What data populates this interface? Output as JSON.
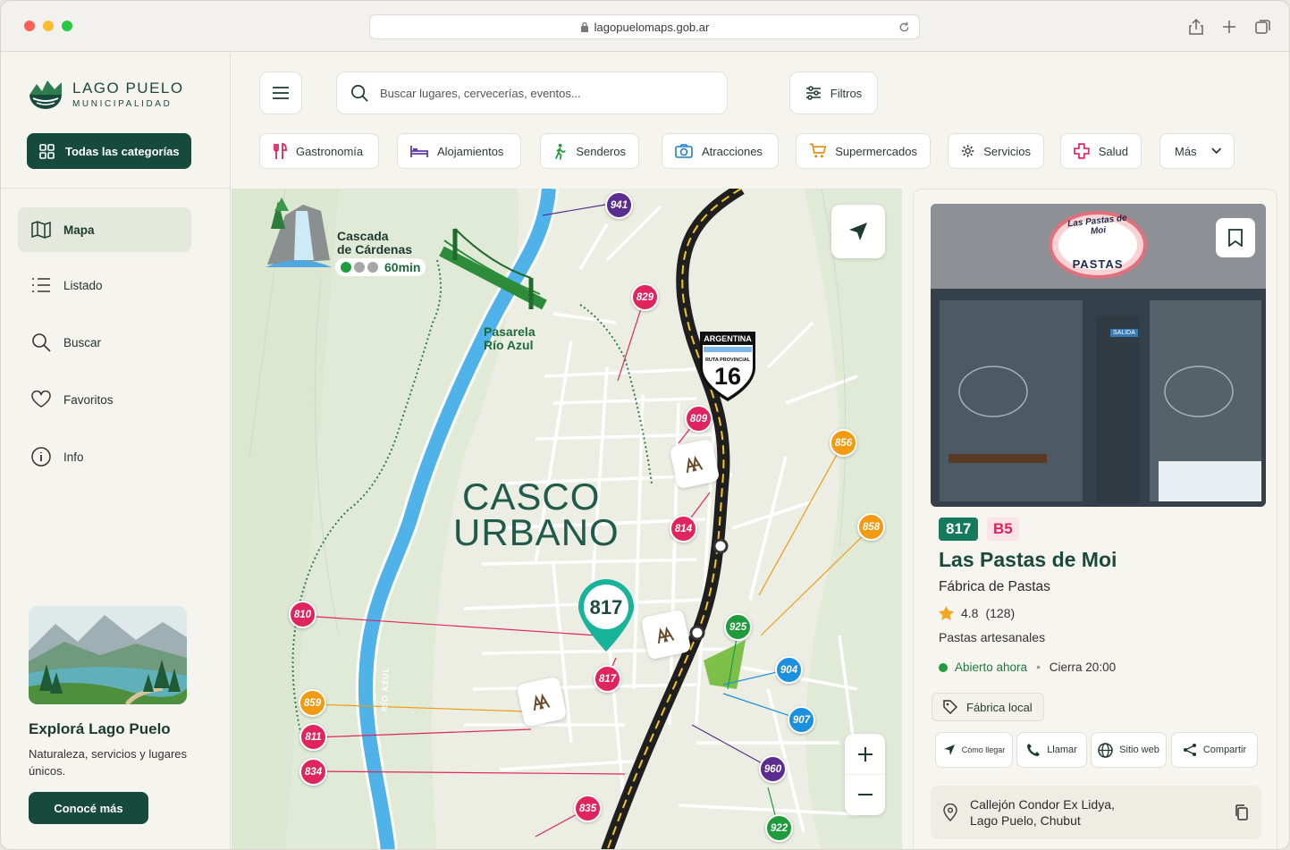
{
  "browser": {
    "url": "lagopuelomaps.gob.ar"
  },
  "brand": {
    "name": "LAGO PUELO",
    "subtitle": "MUNICIPALIDAD"
  },
  "sidebar": {
    "all_categories": "Todas las categorías",
    "items": [
      {
        "label": "Mapa",
        "icon": "map-icon",
        "active": true
      },
      {
        "label": "Listado",
        "icon": "list-icon"
      },
      {
        "label": "Buscar",
        "icon": "search-icon"
      },
      {
        "label": "Favoritos",
        "icon": "heart-icon"
      },
      {
        "label": "Info",
        "icon": "info-icon"
      }
    ],
    "promo": {
      "title": "Explorá Lago Puelo",
      "text": "Naturaleza, servicios y lugares únicos.",
      "button": "Conocé más"
    }
  },
  "search": {
    "placeholder": "Buscar lugares, cervecerías, eventos..."
  },
  "filters_label": "Filtros",
  "categories": [
    {
      "label": "Gastronomía",
      "icon": "fork-knife-icon",
      "color": "#e0245e"
    },
    {
      "label": "Alojamientos",
      "icon": "bed-icon",
      "color": "#5b3ea8"
    },
    {
      "label": "Senderos",
      "icon": "hiker-icon",
      "color": "#1f9a3c"
    },
    {
      "label": "Atracciones",
      "icon": "camera-icon",
      "color": "#1b7fd0"
    },
    {
      "label": "Supermercados",
      "icon": "cart-icon",
      "color": "#e38a0c"
    },
    {
      "label": "Servicios",
      "icon": "gear-icon",
      "color": "#333333"
    },
    {
      "label": "Salud",
      "icon": "cross-icon",
      "color": "#e0245e"
    },
    {
      "label": "Más",
      "icon": "chevron-down-icon",
      "color": "#333333"
    }
  ],
  "map": {
    "area_label_1": "CASCO",
    "area_label_2": "URBANO",
    "waterfall_label_1": "Cascada",
    "waterfall_label_2": "de Cárdenas",
    "waterfall_time": "60min",
    "bridge_label_1": "Pasarela",
    "bridge_label_2": "Río Azul",
    "river_label": "RÍO AZUL",
    "route_sign_top": "ARGENTINA",
    "route_sign_mid": "RUTA PROVINCIAL",
    "route_sign_num": "16",
    "selected_pin": "817",
    "pins": [
      {
        "num": "941",
        "color": "#5b2d8e"
      },
      {
        "num": "829",
        "color": "#e0245e"
      },
      {
        "num": "809",
        "color": "#e0245e"
      },
      {
        "num": "856",
        "color": "#f29a12"
      },
      {
        "num": "814",
        "color": "#e0245e"
      },
      {
        "num": "858",
        "color": "#f29a12"
      },
      {
        "num": "810",
        "color": "#e0245e"
      },
      {
        "num": "925",
        "color": "#1f9a3c"
      },
      {
        "num": "904",
        "color": "#1b8fe0"
      },
      {
        "num": "817",
        "color": "#e0245e"
      },
      {
        "num": "907",
        "color": "#1b8fe0"
      },
      {
        "num": "859",
        "color": "#f29a12"
      },
      {
        "num": "811",
        "color": "#e0245e"
      },
      {
        "num": "834",
        "color": "#e0245e"
      },
      {
        "num": "960",
        "color": "#5b2d8e"
      },
      {
        "num": "835",
        "color": "#e0245e"
      },
      {
        "num": "922",
        "color": "#1f9a3c"
      }
    ]
  },
  "detail": {
    "number": "817",
    "sector": "B5",
    "name": "Las Pastas de Moi",
    "category": "Fábrica de Pastas",
    "rating": "4.8",
    "reviews": "(128)",
    "description": "Pastas artesanales",
    "open_status": "Abierto ahora",
    "separator": "•",
    "closes": "Cierra 20:00",
    "tag": "Fábrica local",
    "sign_line1": "Las Pastas de Moi",
    "sign_line2": "PASTAS",
    "door_label": "SALIDA",
    "actions": [
      {
        "label": "Cómo llegar",
        "icon": "navigate-icon"
      },
      {
        "label": "Llamar",
        "icon": "phone-icon"
      },
      {
        "label": "Sitio web",
        "icon": "globe-icon"
      },
      {
        "label": "Compartir",
        "icon": "share-icon"
      }
    ],
    "address_line1": "Callejón Condor Ex Lidya,",
    "address_line2": "Lago Puelo, Chubut"
  }
}
